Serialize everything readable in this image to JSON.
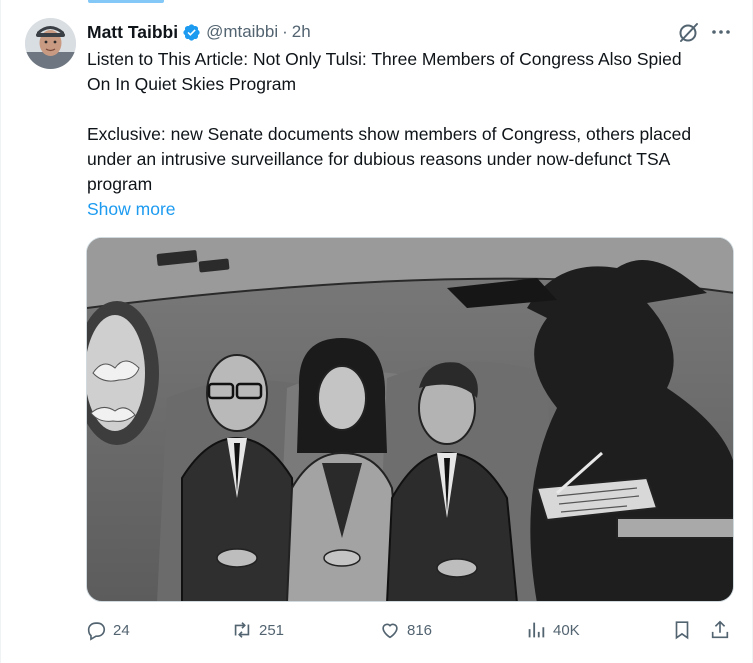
{
  "tweet": {
    "author_name": "Matt Taibbi",
    "handle": "@mtaibbi",
    "separator": "·",
    "time": "2h",
    "text_line_1": "Listen to This Article: Not Only Tulsi: Three Members of Congress Also Spied On In Quiet Skies Program",
    "text_line_2": "Exclusive: new Senate documents show members of Congress, others placed under an intrusive surveillance for dubious reasons under now-defunct TSA program",
    "show_more": "Show more"
  },
  "stats": {
    "replies": "24",
    "reposts": "251",
    "likes": "816",
    "views": "40K"
  },
  "colors": {
    "accent": "#1d9bf0",
    "muted": "#536471",
    "text": "#0f1419"
  },
  "icons": {
    "verified": "verified-badge-icon",
    "grok": "grok-icon",
    "more": "more-icon",
    "reply": "reply-icon",
    "repost": "repost-icon",
    "like": "heart-icon",
    "views": "views-icon",
    "bookmark": "bookmark-icon",
    "share": "share-icon"
  }
}
